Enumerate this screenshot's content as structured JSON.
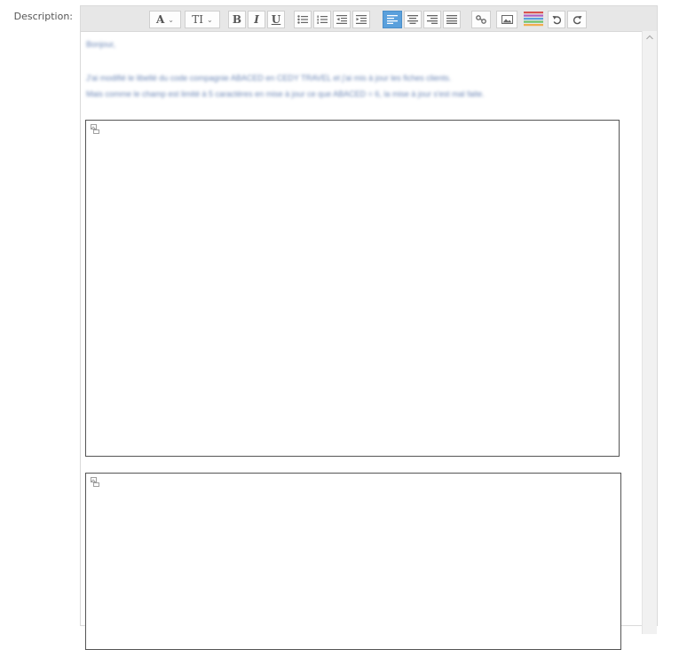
{
  "field": {
    "label": "Description:"
  },
  "toolbar": {
    "font_label": "A",
    "size_label": "TI",
    "bold_label": "B",
    "italic_label": "I",
    "underline_label": "U",
    "dropdown_glyph": "⌄",
    "active_button": "align-left"
  },
  "content": {
    "greeting": "Bonjour,",
    "line1": "J'ai modifié le libellé du code compagnie ABACED en CEDY TRAVEL et j'ai mis à jour les fiches clients.",
    "line2": "Mais comme le champ est limité à 5 caractères en mise à jour ce que ABACED = 6, la mise à jour s'est mal faite."
  },
  "colors": {
    "accent": "#5aa0dc",
    "toolbar_bg": "#e7e7e7",
    "blur_text": "#6b86b5"
  }
}
